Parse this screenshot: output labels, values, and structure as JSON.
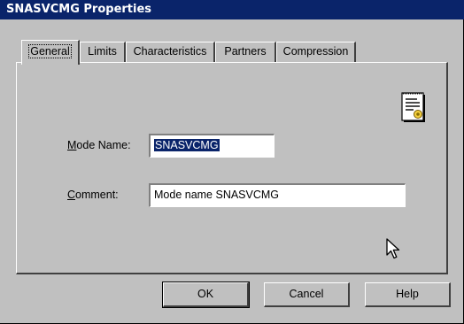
{
  "window": {
    "title": "SNASVCMG Properties"
  },
  "tabs": [
    {
      "label": "General",
      "active": true
    },
    {
      "label": "Limits",
      "active": false
    },
    {
      "label": "Characteristics",
      "active": false
    },
    {
      "label": "Partners",
      "active": false
    },
    {
      "label": "Compression",
      "active": false
    }
  ],
  "form": {
    "mode_name_label_accel": "M",
    "mode_name_label_rest": "ode Name:",
    "mode_name_value": "SNASVCMG",
    "comment_label_accel": "C",
    "comment_label_rest": "omment:",
    "comment_value": "Mode name SNASVCMG"
  },
  "icons": {
    "properties": "document-properties-icon",
    "cursor": "mouse-pointer-icon"
  },
  "buttons": {
    "ok": "OK",
    "cancel": "Cancel",
    "help": "Help"
  },
  "colors": {
    "titlebar": "#0a246a",
    "face": "#c0c0c0",
    "selection": "#0a246a"
  }
}
